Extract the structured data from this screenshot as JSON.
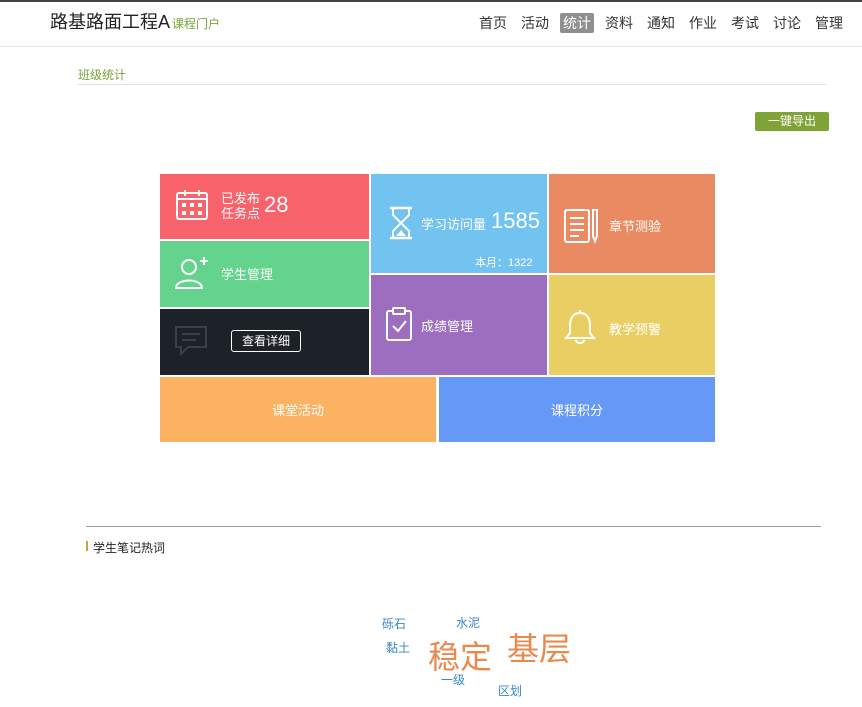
{
  "header": {
    "course_name": "路基路面工程A",
    "portal_label": "课程门户",
    "nav": [
      "首页",
      "活动",
      "统计",
      "资料",
      "通知",
      "作业",
      "考试",
      "讨论",
      "管理"
    ],
    "active_nav": "统计"
  },
  "section": {
    "title": "班级统计",
    "export_label": "一键导出"
  },
  "tiles": {
    "task": {
      "line1": "已发布",
      "line2": "任务点",
      "count": "28"
    },
    "visits": {
      "label": "学习访问量",
      "count": "1585",
      "month_label": "本月：1322"
    },
    "chapter_quiz": {
      "label": "章节测验"
    },
    "student_mgmt": {
      "label": "学生管理"
    },
    "grade_mgmt": {
      "label": "成绩管理"
    },
    "teaching_alert": {
      "label": "教学预警"
    },
    "discussion": {
      "detail_label": "查看详细"
    },
    "class_activity": {
      "label": "课堂活动"
    },
    "course_points": {
      "label": "课程积分"
    }
  },
  "notes": {
    "title": "学生笔记热词",
    "words": [
      "砾石",
      "水泥",
      "黏土",
      "稳定",
      "基层",
      "一级",
      "区划"
    ]
  },
  "colors": {
    "accent": "#7fa337",
    "task": "#f8626a",
    "visits": "#72c3ef",
    "chapter": "#ea8a62",
    "student": "#63d38e",
    "grade": "#9d6ebf",
    "alert": "#e9cf63",
    "discussion": "#1d2228",
    "activity": "#fcb263",
    "points": "#6699f5",
    "word_blue": "#3a86c8",
    "word_orange": "#e8894e"
  }
}
